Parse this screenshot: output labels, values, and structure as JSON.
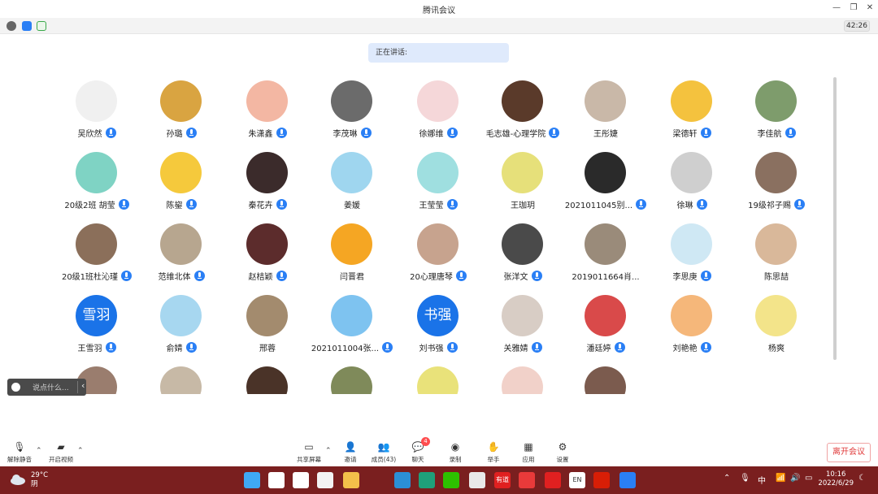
{
  "window": {
    "title": "腾讯会议"
  },
  "status": {
    "timer": "42:26"
  },
  "speaking_label": "正在讲话:",
  "participants": [
    {
      "name": "吴欣然",
      "mic": true,
      "bg": "#f0f0f0"
    },
    {
      "name": "孙璐",
      "mic": true,
      "bg": "#d9a441"
    },
    {
      "name": "朱潇鑫",
      "mic": true,
      "bg": "#f3b7a3"
    },
    {
      "name": "李茂琳",
      "mic": true,
      "bg": "#6b6b6b"
    },
    {
      "name": "徐娜维",
      "mic": true,
      "bg": "#f5d7d9"
    },
    {
      "name": "毛志雄-心理学院",
      "mic": true,
      "bg": "#5a3a2a"
    },
    {
      "name": "王彤婕",
      "mic": false,
      "bg": "#c9b8a8"
    },
    {
      "name": "梁德轩",
      "mic": true,
      "bg": "#f4c23e"
    },
    {
      "name": "李佳航",
      "mic": true,
      "bg": "#7e9c6c"
    },
    {
      "name": "20级2班 胡莹",
      "mic": true,
      "bg": "#7fd3c4",
      "text": ""
    },
    {
      "name": "陈鋆",
      "mic": true,
      "bg": "#f5c93c"
    },
    {
      "name": "秦花卉",
      "mic": true,
      "bg": "#3b2b2b"
    },
    {
      "name": "姜媛",
      "mic": false,
      "bg": "#9fd6ef"
    },
    {
      "name": "王莹莹",
      "mic": true,
      "bg": "#9fdfe0"
    },
    {
      "name": "王珈玥",
      "mic": false,
      "bg": "#e6e07a"
    },
    {
      "name": "2021011045别...",
      "mic": true,
      "bg": "#2a2a2a"
    },
    {
      "name": "徐琳",
      "mic": true,
      "bg": "#cfcfcf"
    },
    {
      "name": "19级祁子赐",
      "mic": true,
      "bg": "#8a7060"
    },
    {
      "name": "20级1班杜沁瑾",
      "mic": true,
      "bg": "#8b6f5a"
    },
    {
      "name": "范维北体",
      "mic": true,
      "bg": "#b7a68f"
    },
    {
      "name": "赵桔颖",
      "mic": true,
      "bg": "#5c2c2c"
    },
    {
      "name": "闫晋君",
      "mic": false,
      "bg": "#f5a623"
    },
    {
      "name": "20心理唐琴",
      "mic": true,
      "bg": "#c7a38e"
    },
    {
      "name": "张洋文",
      "mic": true,
      "bg": "#4a4a4a"
    },
    {
      "name": "2019011664肖...",
      "mic": false,
      "bg": "#9a8b7a"
    },
    {
      "name": "李思庚",
      "mic": true,
      "bg": "#cfe8f4"
    },
    {
      "name": "陈思喆",
      "mic": false,
      "bg": "#d9b89a"
    },
    {
      "name": "王雪羽",
      "mic": true,
      "bg": "#1a73e8",
      "text": "雪羽"
    },
    {
      "name": "俞婧",
      "mic": true,
      "bg": "#a7d7f0"
    },
    {
      "name": "邢蓉",
      "mic": false,
      "bg": "#a38b6e"
    },
    {
      "name": "2021011004张...",
      "mic": true,
      "bg": "#7ec3f0"
    },
    {
      "name": "刘书强",
      "mic": true,
      "bg": "#1a73e8",
      "text": "书强"
    },
    {
      "name": "关雅婧",
      "mic": true,
      "bg": "#d8cdc5"
    },
    {
      "name": "潘廷婷",
      "mic": true,
      "bg": "#d94a4a"
    },
    {
      "name": "刘艳艳",
      "mic": true,
      "bg": "#f5b77a"
    },
    {
      "name": "杨爽",
      "mic": false,
      "bg": "#f3e48a"
    },
    {
      "name": "",
      "mic": false,
      "bg": "#9a7d6e"
    },
    {
      "name": "",
      "mic": false,
      "bg": "#c7b9a6"
    },
    {
      "name": "",
      "mic": false,
      "bg": "#4a3328"
    },
    {
      "name": "",
      "mic": false,
      "bg": "#7f8a5a"
    },
    {
      "name": "",
      "mic": false,
      "bg": "#e9e27a"
    },
    {
      "name": "",
      "mic": false,
      "bg": "#f1d1c9"
    },
    {
      "name": "",
      "mic": false,
      "bg": "#7b5b4e"
    }
  ],
  "chat": {
    "placeholder": "说点什么..."
  },
  "toolbar": {
    "mute_label": "解除静音",
    "video_label": "开启视频",
    "share_label": "共享屏幕",
    "invite_label": "邀请",
    "members_label": "成员(43)",
    "chat_label": "聊天",
    "chat_badge": "4",
    "record_label": "录制",
    "raise_label": "举手",
    "apps_label": "应用",
    "settings_label": "设置",
    "leave_label": "离开会议"
  },
  "taskbar": {
    "temperature": "29°C",
    "weather": "阴",
    "ime_lang": "中",
    "time": "10:16",
    "date": "2022/6/29",
    "app_icons": [
      "windows-icon",
      "search-icon",
      "task-view-icon",
      "store-icon",
      "folder-icon",
      "edge-icon",
      "edge-dev-icon",
      "wechat-icon",
      "chrome-icon",
      "youdao-icon",
      "xmind-icon",
      "neteasecloud-icon",
      "en-icon",
      "wps-icon",
      "tencent-meeting-icon"
    ],
    "app_labels": [
      "",
      "",
      "",
      "",
      "",
      "",
      "",
      "",
      "",
      "有道",
      "",
      "",
      "EN",
      "",
      ""
    ],
    "app_colors": [
      "#3fa9f5",
      "#ffffff",
      "#ffffff",
      "#f3f3f3",
      "#f3c04a",
      "#2b8fd6",
      "#1fa07a",
      "#2dc100",
      "#e9e9e9",
      "#e02020",
      "#e83a3a",
      "#e02020",
      "#ffffff",
      "#d81e06",
      "#2a7ff5"
    ]
  }
}
